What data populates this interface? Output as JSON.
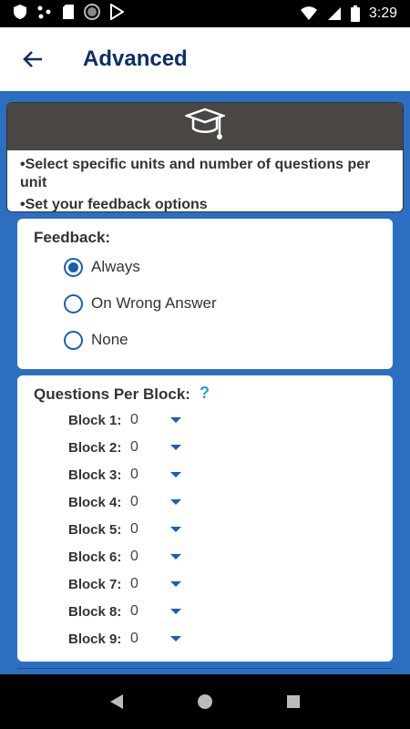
{
  "status": {
    "time": "3:29"
  },
  "appbar": {
    "title": "Advanced"
  },
  "info": {
    "line1": "•Select specific units and number of questions per unit",
    "line2": "•Set your feedback options"
  },
  "feedback": {
    "label": "Feedback:",
    "options": [
      {
        "label": "Always",
        "selected": true
      },
      {
        "label": "On Wrong Answer",
        "selected": false
      },
      {
        "label": "None",
        "selected": false
      }
    ]
  },
  "questions": {
    "label": "Questions Per Block:",
    "help_icon": "?",
    "blocks": [
      {
        "label": "Block 1:",
        "value": "0"
      },
      {
        "label": "Block 2:",
        "value": "0"
      },
      {
        "label": "Block 3:",
        "value": "0"
      },
      {
        "label": "Block 4:",
        "value": "0"
      },
      {
        "label": "Block 5:",
        "value": "0"
      },
      {
        "label": "Block 6:",
        "value": "0"
      },
      {
        "label": "Block 7:",
        "value": "0"
      },
      {
        "label": "Block 8:",
        "value": "0"
      },
      {
        "label": "Block 9:",
        "value": "0"
      }
    ]
  },
  "colors": {
    "accent": "#1a5eb0",
    "background": "#2c6fc2",
    "title": "#0d2f67"
  }
}
